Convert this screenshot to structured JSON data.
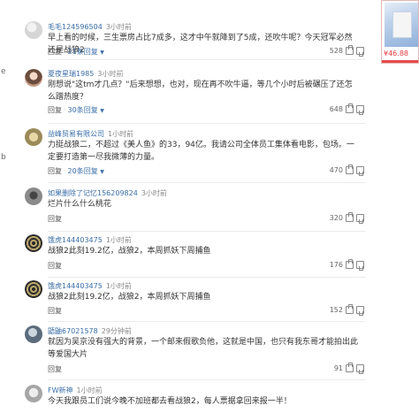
{
  "left_fragments": [
    "e",
    "b"
  ],
  "ad": {
    "price": "¥46.88"
  },
  "comments": [
    {
      "username": "毛毛124596504",
      "time": "3小时前",
      "text": "早上看的时候，三生票房占比7成多，这才中午就降到了5成，还吹牛呢？今天冠军必然还是战狼2",
      "reply": "回复",
      "replies_count": "21条回复",
      "likes": "528"
    },
    {
      "username": "夏夜星瑞1985",
      "time": "3小时前",
      "text": "刚想说\"这tm才几点？\"后来想想，也对，现在再不吹牛逼，等几个小时后被碾压了还怎么蹭热度？",
      "reply": "回复",
      "replies_count": "30条回复",
      "likes": "648"
    },
    {
      "username": "益峰贸易有限公司",
      "time": "1小时前",
      "text": "力挺战狼二，不超过《美人鱼》的33，94亿。我请公司全体员工集体看电影，包场。一定要打造第一尽我微薄的力量。",
      "reply": "回复",
      "replies_count": "20条回复",
      "likes": "470"
    },
    {
      "username": "如果删除了记忆156209824",
      "time": "3小时前",
      "text": "烂片什么什么桃花",
      "reply": "回复",
      "replies_count": "",
      "likes": "320"
    },
    {
      "username": "饿虎144403475",
      "time": "1小时前",
      "text": "战狼2此刻19.2亿，战狼2，本周抓妖下周捕鱼",
      "reply": "回复",
      "replies_count": "",
      "likes": "176"
    },
    {
      "username": "饿虎144403475",
      "time": "1小时前",
      "text": "战狼2此刻19.2亿，战狼2，本周抓妖下周捕鱼",
      "reply": "回复",
      "replies_count": "",
      "likes": "152"
    },
    {
      "username": "鼯鼬67021578",
      "time": "29分钟前",
      "text": "就因为吴京没有强大的背景，一个邮来假歌负他，这就是中国，也只有我东哥才能拍出此等爱国大片",
      "reply": "回复",
      "replies_count": "",
      "likes": "91"
    },
    {
      "username": "FW新神",
      "time": "1小时前",
      "text": "今天我跟员工们说今晚不加班都去看战狼2，每人票据拿回来报一半！",
      "reply": "",
      "replies_count": "",
      "likes": ""
    }
  ]
}
